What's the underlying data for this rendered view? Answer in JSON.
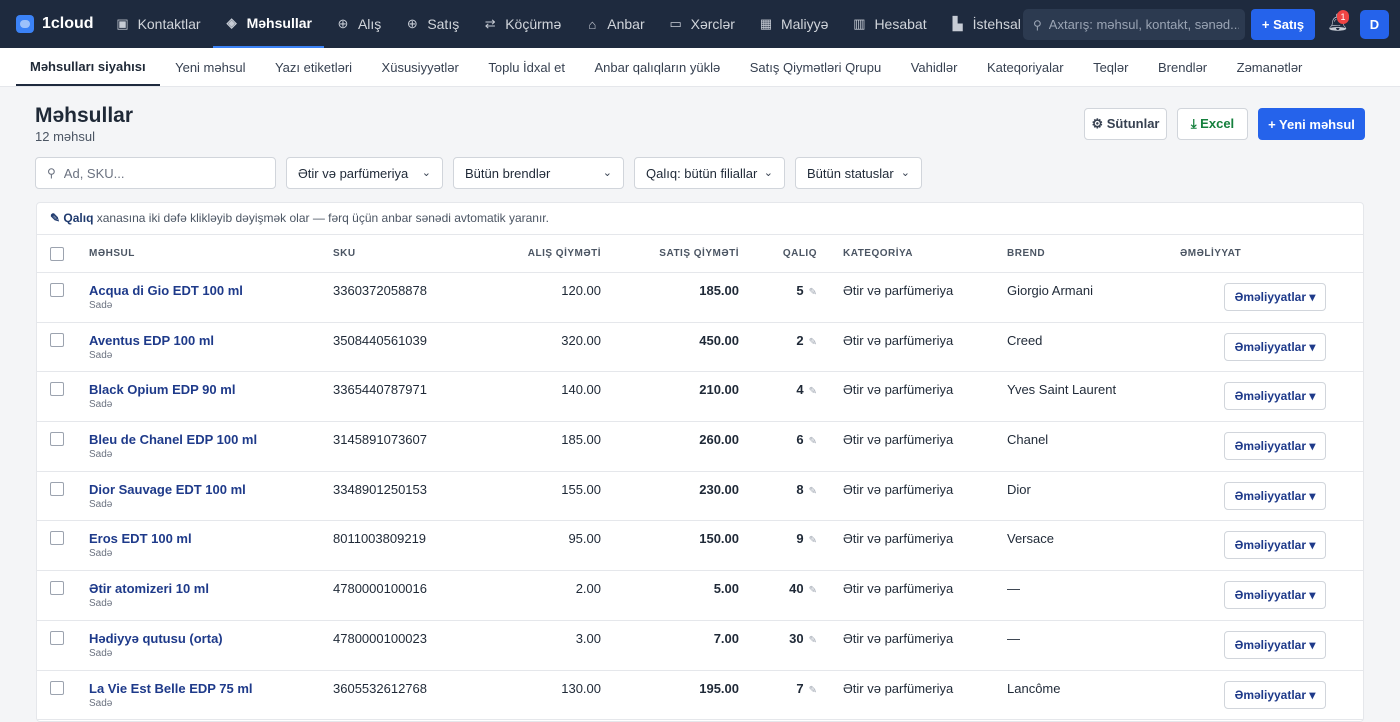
{
  "app": {
    "name": "1cloud"
  },
  "topnav": [
    {
      "label": "Kontaktlar",
      "icon": "contacts-icon",
      "glyph": "▣"
    },
    {
      "label": "Məhsullar",
      "icon": "box-icon",
      "glyph": "◈",
      "active": true
    },
    {
      "label": "Alış",
      "icon": "purchase-icon",
      "glyph": "⊕"
    },
    {
      "label": "Satış",
      "icon": "sale-icon",
      "glyph": "⊕"
    },
    {
      "label": "Köçürmə",
      "icon": "transfer-icon",
      "glyph": "⇄"
    },
    {
      "label": "Anbar",
      "icon": "warehouse-icon",
      "glyph": "⌂"
    },
    {
      "label": "Xərclər",
      "icon": "expenses-icon",
      "glyph": "▭"
    },
    {
      "label": "Maliyyə",
      "icon": "finance-icon",
      "glyph": "▦"
    },
    {
      "label": "Hesabat",
      "icon": "report-icon",
      "glyph": "▥"
    },
    {
      "label": "İstehsal",
      "icon": "production-icon",
      "glyph": "▙"
    }
  ],
  "search": {
    "placeholder": "Axtarış: məhsul, kontakt, sənəd..."
  },
  "header_actions": {
    "sale_label": "+ Satış",
    "notifications": "1",
    "avatar": "D"
  },
  "subnav": [
    {
      "label": "Məhsulları siyahısı",
      "active": true
    },
    {
      "label": "Yeni məhsul"
    },
    {
      "label": "Yazı etiketləri"
    },
    {
      "label": "Xüsusiyyətlər"
    },
    {
      "label": "Toplu İdxal et"
    },
    {
      "label": "Anbar qalıqların yüklə"
    },
    {
      "label": "Satış Qiymətləri Qrupu"
    },
    {
      "label": "Vahidlər"
    },
    {
      "label": "Kateqoriyalar"
    },
    {
      "label": "Teqlər"
    },
    {
      "label": "Brendlər"
    },
    {
      "label": "Zəmanətlər"
    }
  ],
  "page": {
    "title": "Məhsullar",
    "subtitle": "12 məhsul"
  },
  "toolbar": {
    "columns_label": "⚙ Sütunlar",
    "excel_label": "⤓ Excel",
    "new_label": "+ Yeni məhsul"
  },
  "filters": {
    "search_placeholder": "Ad, SKU...",
    "category": "Ətir və parfümeriya",
    "brands": "Bütün brendlər",
    "stock": "Qalıq: bütün filiallar",
    "status": "Bütün statuslar"
  },
  "hint": {
    "strong": "✎ Qalıq",
    "text": " xanasına iki dəfə klikləyib dəyişmək olar — fərq üçün anbar sənədi avtomatik yaranır."
  },
  "columns": {
    "product": "MƏHSUL",
    "sku": "SKU",
    "buy_price": "ALIŞ QİYMƏTİ",
    "sell_price": "SATIŞ QİYMƏTİ",
    "stock": "QALIQ",
    "category": "KATEQORİYA",
    "brand": "BREND",
    "actions": "ƏMƏLİYYAT"
  },
  "row_action_label": "Əməliyyatlar ▾",
  "rows": [
    {
      "name": "Acqua di Gio EDT 100 ml",
      "type": "Sadə",
      "sku": "3360372058878",
      "buy": "120.00",
      "sell": "185.00",
      "stock": "5",
      "category": "Ətir və parfümeriya",
      "brand": "Giorgio Armani"
    },
    {
      "name": "Aventus EDP 100 ml",
      "type": "Sadə",
      "sku": "3508440561039",
      "buy": "320.00",
      "sell": "450.00",
      "stock": "2",
      "category": "Ətir və parfümeriya",
      "brand": "Creed"
    },
    {
      "name": "Black Opium EDP 90 ml",
      "type": "Sadə",
      "sku": "3365440787971",
      "buy": "140.00",
      "sell": "210.00",
      "stock": "4",
      "category": "Ətir və parfümeriya",
      "brand": "Yves Saint Laurent"
    },
    {
      "name": "Bleu de Chanel EDP 100 ml",
      "type": "Sadə",
      "sku": "3145891073607",
      "buy": "185.00",
      "sell": "260.00",
      "stock": "6",
      "category": "Ətir və parfümeriya",
      "brand": "Chanel"
    },
    {
      "name": "Dior Sauvage EDT 100 ml",
      "type": "Sadə",
      "sku": "3348901250153",
      "buy": "155.00",
      "sell": "230.00",
      "stock": "8",
      "category": "Ətir və parfümeriya",
      "brand": "Dior"
    },
    {
      "name": "Eros EDT 100 ml",
      "type": "Sadə",
      "sku": "8011003809219",
      "buy": "95.00",
      "sell": "150.00",
      "stock": "9",
      "category": "Ətir və parfümeriya",
      "brand": "Versace"
    },
    {
      "name": "Ətir atomizeri 10 ml",
      "type": "Sadə",
      "sku": "4780000100016",
      "buy": "2.00",
      "sell": "5.00",
      "stock": "40",
      "category": "Ətir və parfümeriya",
      "brand": "—"
    },
    {
      "name": "Hədiyyə qutusu (orta)",
      "type": "Sadə",
      "sku": "4780000100023",
      "buy": "3.00",
      "sell": "7.00",
      "stock": "30",
      "category": "Ətir və parfümeriya",
      "brand": "—"
    },
    {
      "name": "La Vie Est Belle EDP 75 ml",
      "type": "Sadə",
      "sku": "3605532612768",
      "buy": "130.00",
      "sell": "195.00",
      "stock": "7",
      "category": "Ətir və parfümeriya",
      "brand": "Lancôme"
    }
  ]
}
